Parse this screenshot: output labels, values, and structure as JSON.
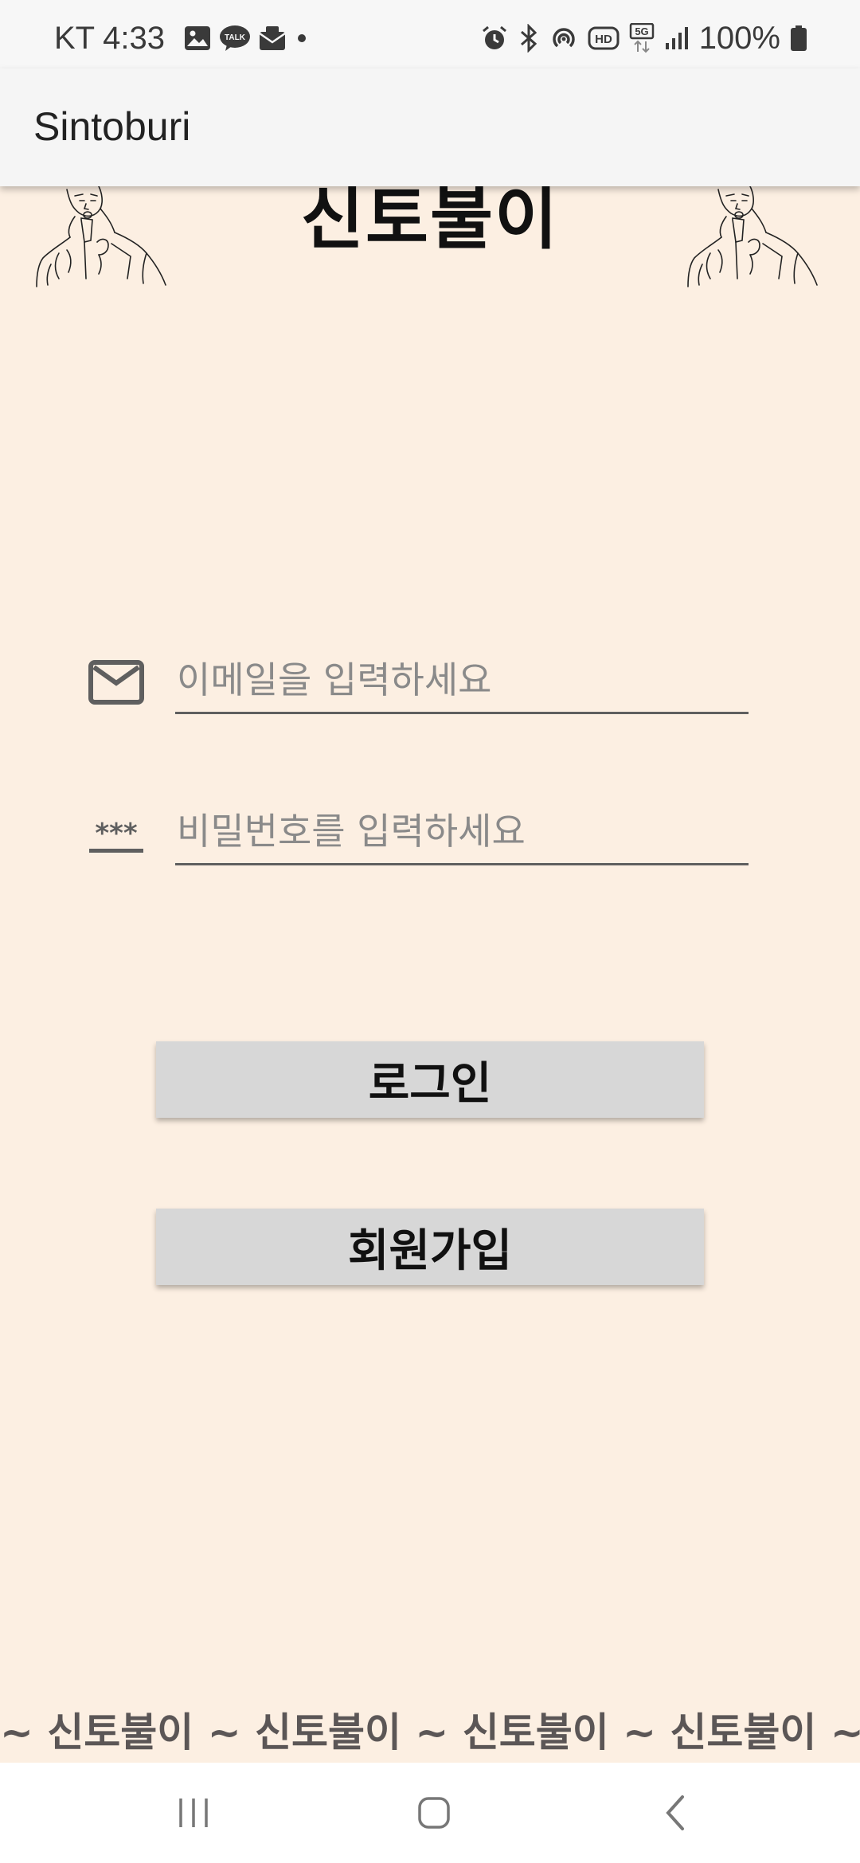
{
  "status_bar": {
    "carrier": "KT",
    "time": "4:33",
    "battery": "100%",
    "left_icons": [
      "gallery-icon",
      "kakaotalk-icon",
      "mail-icon",
      "dot-icon"
    ],
    "right_icons": [
      "alarm-icon",
      "bluetooth-icon",
      "hotspot-icon",
      "hd-icon",
      "5g-icon",
      "signal-icon",
      "battery-icon"
    ]
  },
  "app_bar": {
    "title": "Sintoburi"
  },
  "header": {
    "title": "신토불이"
  },
  "form": {
    "email_placeholder": "이메일을 입력하세요",
    "password_placeholder": "비밀번호를 입력하세요",
    "password_icon_text": "***"
  },
  "buttons": {
    "login": "로그인",
    "signup": "회원가입"
  },
  "footer": {
    "marquee": "~ 신토불이 ~ 신토불이 ~ 신토불이 ~ 신토불이 ~"
  },
  "colors": {
    "background": "#fcefe2",
    "app_bar": "#f5f5f5",
    "button": "#d7d7d7",
    "marquee_text": "#5b5656"
  }
}
